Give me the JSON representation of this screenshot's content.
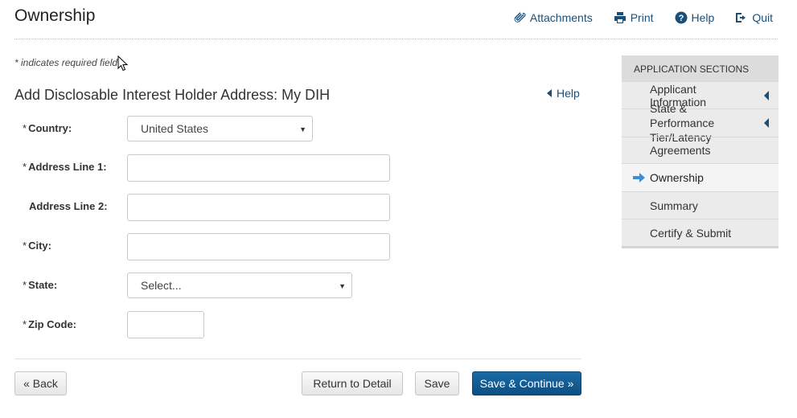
{
  "header": {
    "title": "Ownership",
    "links": {
      "attachments": "Attachments",
      "print": "Print",
      "help": "Help",
      "quit": "Quit"
    }
  },
  "form": {
    "required_note": "* indicates required field",
    "title": "Add Disclosable Interest Holder Address: My DIH",
    "help": "Help",
    "fields": {
      "country": {
        "required": "*",
        "label": "Country:",
        "value": "United States"
      },
      "address1": {
        "required": "*",
        "label": "Address Line 1:",
        "value": ""
      },
      "address2": {
        "label": "Address Line 2:",
        "value": ""
      },
      "city": {
        "required": "*",
        "label": "City:",
        "value": ""
      },
      "state": {
        "required": "*",
        "label": "State:",
        "value": "Select..."
      },
      "zip": {
        "required": "*",
        "label": "Zip Code:",
        "value": ""
      }
    },
    "buttons": {
      "back": "« Back",
      "return": "Return to Detail",
      "save": "Save",
      "save_continue": "Save & Continue »"
    }
  },
  "sidebar": {
    "heading": "APPLICATION SECTIONS",
    "items": [
      {
        "label": "Applicant Information",
        "expandable": true
      },
      {
        "label": "State & Performance Tier/Latency",
        "expandable": true
      },
      {
        "label": "Agreements"
      },
      {
        "label": "Ownership",
        "current": true
      },
      {
        "label": "Summary"
      },
      {
        "label": "Certify & Submit"
      }
    ]
  },
  "colors": {
    "link": "#1a4f7a",
    "primary_button": "#0d4f82",
    "sidebar_bg": "#ebebeb"
  }
}
